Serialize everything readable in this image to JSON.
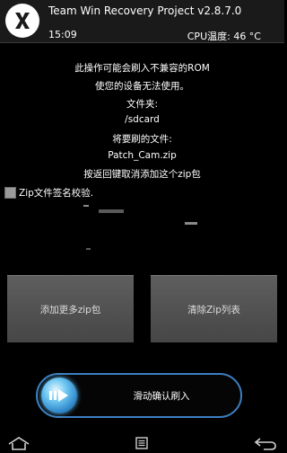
{
  "header": {
    "title": "Team Win Recovery Project  v2.8.7.0",
    "time": "15:09",
    "cpu": "CPU温度: 46 °C"
  },
  "messages": [
    "此操作可能会刷入不兼容的ROM",
    "使您的设备无法使用。",
    "文件夹:",
    "/sdcard",
    "将要刷的文件:",
    "Patch_Cam.zip",
    "按返回键取消添加这个zip包"
  ],
  "checkbox": {
    "label": "Zip文件签名校验.",
    "checked": false
  },
  "buttons": {
    "add_more": "添加更多zip包",
    "clear_list": "清除Zip列表"
  },
  "slider": {
    "label": "滑动确认刷入"
  },
  "icons": {
    "logo": "twrp-logo-icon",
    "home": "home-icon",
    "log": "log-icon",
    "back": "back-icon"
  },
  "colors": {
    "accent": "#3d7fc0",
    "button": "#555555",
    "background": "#000000"
  }
}
